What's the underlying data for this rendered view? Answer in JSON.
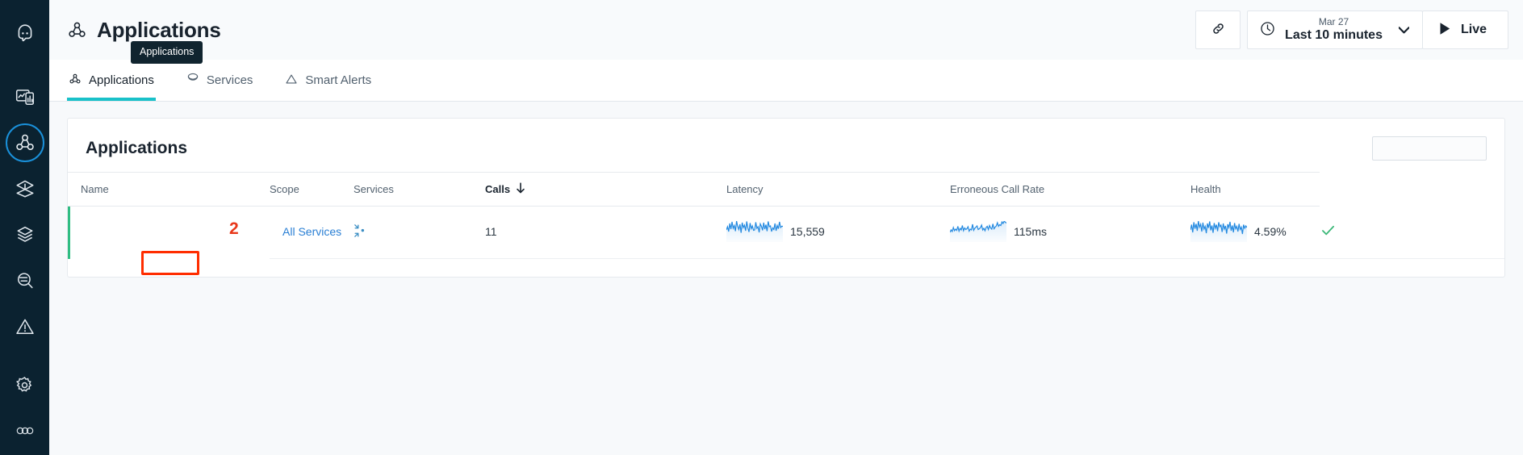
{
  "rail": {
    "items": [
      {
        "name": "robot-logo-icon",
        "label": "Home"
      },
      {
        "name": "dashboard-icon",
        "label": "Dashboards"
      },
      {
        "name": "applications-icon",
        "label": "Applications"
      },
      {
        "name": "analyze-icon",
        "label": "Analytics"
      },
      {
        "name": "infrastructure-icon",
        "label": "Infrastructure"
      },
      {
        "name": "search-logs-icon",
        "label": "Log Search"
      },
      {
        "name": "alerts-icon",
        "label": "Events"
      },
      {
        "name": "settings-icon",
        "label": "Settings"
      },
      {
        "name": "more-icon",
        "label": "More"
      }
    ]
  },
  "header": {
    "title": "Applications",
    "icon": "applications-icon",
    "tooltip": "Applications",
    "share_icon": "link-icon",
    "time_picker": {
      "icon": "clock-icon",
      "date": "Mar 27",
      "range": "Last 10 minutes",
      "caret": "chevron-down-icon"
    },
    "live": {
      "icon": "play-icon",
      "label": "Live"
    }
  },
  "tabs": [
    {
      "label": "Applications",
      "icon": "applications-icon",
      "active": true
    },
    {
      "label": "Services",
      "icon": "services-icon",
      "active": false
    },
    {
      "label": "Smart Alerts",
      "icon": "warning-triangle-icon",
      "active": false
    }
  ],
  "card": {
    "title": "Applications",
    "search": {
      "placeholder": "",
      "value": "",
      "icon": "search-icon"
    }
  },
  "table": {
    "columns": [
      {
        "key": "name",
        "label": "Name",
        "sorted": false
      },
      {
        "key": "scope",
        "label": "Scope",
        "sorted": false
      },
      {
        "key": "services",
        "label": "Services",
        "sorted": false
      },
      {
        "key": "calls",
        "label": "Calls",
        "sorted": true,
        "sort_icon": "arrow-down-icon"
      },
      {
        "key": "latency",
        "label": "Latency",
        "sorted": false
      },
      {
        "key": "erroneous",
        "label": "Erroneous Call Rate",
        "sorted": false
      },
      {
        "key": "health",
        "label": "Health",
        "sorted": false
      }
    ],
    "rows": [
      {
        "name": "All Services",
        "scope_icon": "scope-focus-icon",
        "services": "11",
        "calls": "15,559",
        "latency": "115ms",
        "erroneous": "4.59%",
        "health_icon": "check-icon",
        "health_color": "#2fbd82",
        "accent_color": "#2fbd82"
      }
    ]
  },
  "annotation": {
    "number": "2",
    "target": "All Services",
    "color": "#ff2d00"
  },
  "colors": {
    "rail_bg": "#0b2230",
    "accent_teal": "#19c1c9",
    "link_blue": "#2a7fd4",
    "spark_blue": "#2389e0",
    "health_green": "#2fbd82",
    "rail_active_ring": "#1a90d9"
  },
  "chart_data": [
    {
      "type": "line",
      "title": "Calls",
      "values": [
        52,
        60,
        48,
        73,
        55,
        80,
        58,
        66,
        49,
        88,
        61,
        54,
        70,
        45,
        76,
        59,
        67,
        50,
        84,
        57,
        63,
        47,
        78,
        56,
        69,
        52,
        81,
        58,
        64,
        46,
        74,
        61,
        53,
        79,
        55,
        68,
        50,
        86,
        60,
        62,
        48,
        71,
        57,
        75,
        51,
        66,
        54,
        83,
        59,
        63
      ],
      "ylim": [
        40,
        92
      ],
      "label": "15,559"
    },
    {
      "type": "line",
      "title": "Latency",
      "values": [
        40,
        48,
        42,
        55,
        44,
        50,
        45,
        58,
        43,
        52,
        46,
        60,
        44,
        54,
        47,
        51,
        45,
        57,
        43,
        49,
        46,
        62,
        45,
        53,
        48,
        56,
        44,
        50,
        47,
        59,
        45,
        52,
        43,
        55,
        46,
        58,
        48,
        54,
        45,
        61,
        47,
        53,
        50,
        64,
        49,
        57,
        52,
        68,
        58,
        90
      ],
      "ylim": [
        38,
        92
      ],
      "label": "115ms"
    },
    {
      "type": "line",
      "title": "Erroneous Call Rate",
      "values": [
        55,
        70,
        48,
        82,
        60,
        74,
        52,
        88,
        63,
        71,
        50,
        85,
        58,
        66,
        45,
        79,
        61,
        90,
        54,
        68,
        47,
        83,
        59,
        73,
        51,
        86,
        64,
        70,
        49,
        81,
        57,
        67,
        44,
        78,
        62,
        89,
        53,
        72,
        46,
        84,
        60,
        69,
        48,
        80,
        56,
        65,
        43,
        77,
        59,
        71
      ],
      "ylim": [
        40,
        94
      ],
      "label": "4.59%"
    }
  ]
}
